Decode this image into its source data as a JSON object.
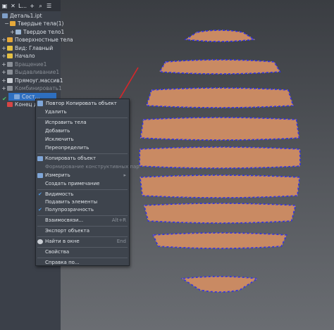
{
  "toolbar": {
    "tab_label": "L..."
  },
  "tree": {
    "root": "Деталь1.ipt",
    "items": [
      {
        "label": "Твердые тела(1)",
        "exp": "−",
        "color": "#e5a83a"
      },
      {
        "label": "Твердое тело1",
        "exp": "+",
        "color": "#9bb6d4"
      },
      {
        "label": "Поверхностные тела",
        "exp": "+",
        "color": "#e5a83a"
      },
      {
        "label": "Вид: Главный",
        "exp": "+",
        "color": "#e5c043"
      },
      {
        "label": "Начало",
        "exp": "+",
        "color": "#e5c043"
      },
      {
        "label": "Вращение1",
        "exp": "+",
        "color": "#8a8f97",
        "dim": true
      },
      {
        "label": "Выдавливание1",
        "exp": "+",
        "color": "#8a8f97",
        "dim": true
      },
      {
        "label": "Прямоуг.массив1",
        "exp": "+",
        "color": "#c9cdd3"
      },
      {
        "label": "Комбинировать1",
        "exp": "+",
        "color": "#8a8f97",
        "dim": true
      },
      {
        "label": "Сост...",
        "exp": "",
        "color": "#7fa6d8"
      },
      {
        "label": "Конец де...",
        "exp": "",
        "color": "#d64545"
      }
    ]
  },
  "menu": {
    "header": "Повтор Копировать объект",
    "items": [
      {
        "label": "Удалить",
        "shortcut": "",
        "disabled": false
      },
      {
        "sep": true
      },
      {
        "label": "Исправить тела",
        "shortcut": "",
        "disabled": false
      },
      {
        "label": "Добавить",
        "shortcut": "",
        "disabled": false
      },
      {
        "label": "Исключить",
        "shortcut": "",
        "disabled": false
      },
      {
        "label": "Переопределить",
        "shortcut": "",
        "disabled": false
      },
      {
        "sep": true
      },
      {
        "label": "Копировать объект",
        "shortcut": "",
        "disabled": false,
        "icon": "copy-icon"
      },
      {
        "label": "Формирование конструктивных пар",
        "shortcut": "",
        "disabled": true
      },
      {
        "label": "Измерить",
        "shortcut": "",
        "disabled": false,
        "arrow": true,
        "icon": "measure-icon"
      },
      {
        "label": "Создать примечание",
        "shortcut": "",
        "disabled": false
      },
      {
        "sep": true
      },
      {
        "label": "Видимость",
        "shortcut": "",
        "disabled": false,
        "check": true
      },
      {
        "label": "Подавить элементы",
        "shortcut": "",
        "disabled": false
      },
      {
        "label": "Полупрозрачность",
        "shortcut": "",
        "disabled": false,
        "check": true
      },
      {
        "sep": true
      },
      {
        "label": "Взаимосвязи...",
        "shortcut": "Alt+R",
        "disabled": false
      },
      {
        "sep": true
      },
      {
        "label": "Экспорт объекта",
        "shortcut": "",
        "disabled": false
      },
      {
        "sep": true
      },
      {
        "label": "Найти в окне",
        "shortcut": "End",
        "disabled": false,
        "icon": "find-icon"
      },
      {
        "sep": true
      },
      {
        "label": "Свойства",
        "shortcut": "",
        "disabled": false
      },
      {
        "sep": true
      },
      {
        "label": "Справка по...",
        "shortcut": "",
        "disabled": false
      }
    ]
  },
  "colors": {
    "band": "#c98a63",
    "dash": "#3030e8",
    "dot": "#e6c23a",
    "arrow": "#d8262a"
  }
}
